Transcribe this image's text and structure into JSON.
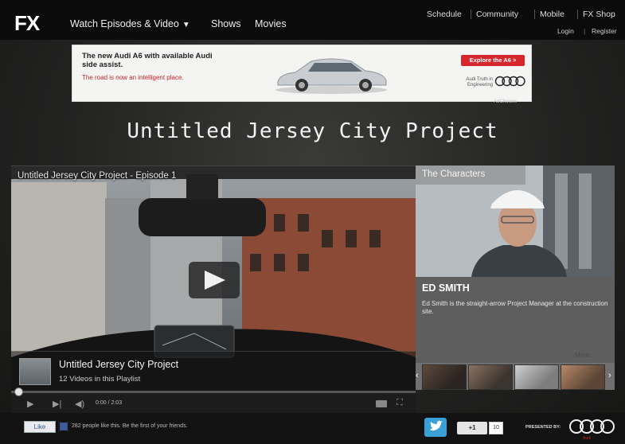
{
  "nav": {
    "logo": "FX",
    "watch_label": "Watch Episodes & Video",
    "watch_caret": "▼",
    "shows_label": "Shows",
    "movies_label": "Movies",
    "utility": [
      "Schedule",
      "Community",
      "Mobile",
      "FX Shop"
    ],
    "login_label": "Login",
    "account_separator": "|",
    "register_label": "Register"
  },
  "ad": {
    "headline": "The new Audi A6 with available Audi side assist.",
    "subline": "The road is now an intelligent place.",
    "cta": "Explore the A6 >",
    "tagline": "Audi Truth in Engineering",
    "choices": "AdChoices",
    "accent": "#d7262e"
  },
  "show_title": "Untitled Jersey City Project",
  "player": {
    "episode_title": "Untitled Jersey City Project - Episode 1",
    "playlist_title": "Untitled Jersey City Project",
    "playlist_count": "12 Videos in this Playlist",
    "time": "0:00 / 2:03",
    "progress": 0.0,
    "icons": [
      "play-icon",
      "next-icon",
      "volume-icon",
      "captions-icon",
      "fullscreen-icon"
    ]
  },
  "characters": {
    "heading": "The Characters",
    "name": "ED SMITH",
    "description": "Ed Smith is the straight-arrow Project Manager at the construction site.",
    "more_label": "More...",
    "prev": "‹",
    "next": "›"
  },
  "footer": {
    "like_label": "Like",
    "like_text": "282 people like this. Be the first of your friends.",
    "gplus_label": "+1",
    "gplus_count": "10",
    "presented_by": "PRESENTED BY:",
    "sponsor": "Audi",
    "twitter_color": "#3aa1d6"
  }
}
